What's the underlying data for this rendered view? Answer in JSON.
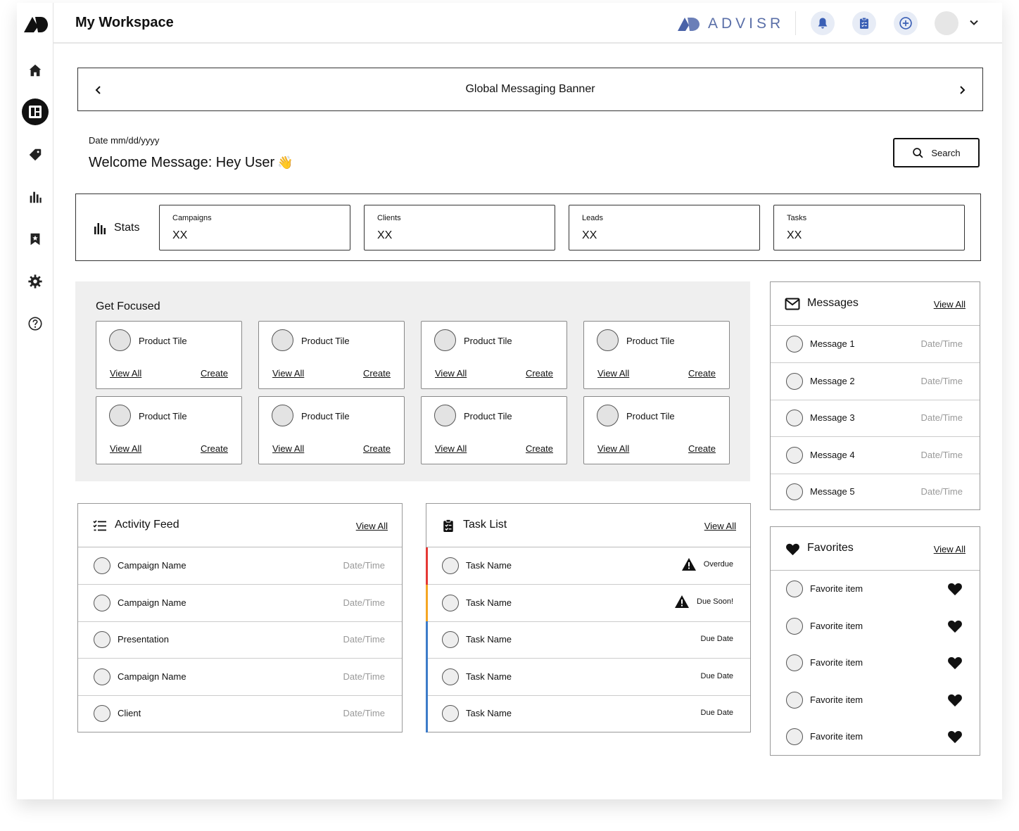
{
  "header": {
    "title": "My Workspace",
    "brand": "ADVISR"
  },
  "banner": {
    "text": "Global Messaging Banner"
  },
  "date_line": "Date mm/dd/yyyy",
  "welcome": "Welcome Message: Hey User",
  "search_label": "Search",
  "stats": {
    "label": "Stats",
    "cards": [
      {
        "label": "Campaigns",
        "value": "XX"
      },
      {
        "label": "Clients",
        "value": "XX"
      },
      {
        "label": "Leads",
        "value": "XX"
      },
      {
        "label": "Tasks",
        "value": "XX"
      }
    ]
  },
  "focused": {
    "title": "Get Focused",
    "tiles": [
      {
        "name": "Product Tile",
        "view": "View All",
        "create": "Create"
      },
      {
        "name": "Product Tile",
        "view": "View All",
        "create": "Create"
      },
      {
        "name": "Product Tile",
        "view": "View All",
        "create": "Create"
      },
      {
        "name": "Product Tile",
        "view": "View All",
        "create": "Create"
      },
      {
        "name": "Product Tile",
        "view": "View All",
        "create": "Create"
      },
      {
        "name": "Product Tile",
        "view": "View All",
        "create": "Create"
      },
      {
        "name": "Product Tile",
        "view": "View All",
        "create": "Create"
      },
      {
        "name": "Product Tile",
        "view": "View All",
        "create": "Create"
      }
    ]
  },
  "messages": {
    "title": "Messages",
    "view_all": "View All",
    "items": [
      {
        "name": "Message 1",
        "date": "Date/Time"
      },
      {
        "name": "Message 2",
        "date": "Date/Time"
      },
      {
        "name": "Message 3",
        "date": "Date/Time"
      },
      {
        "name": "Message 4",
        "date": "Date/Time"
      },
      {
        "name": "Message 5",
        "date": "Date/Time"
      }
    ]
  },
  "activity": {
    "title": "Activity Feed",
    "view_all": "View All",
    "items": [
      {
        "name": "Campaign Name",
        "date": "Date/Time"
      },
      {
        "name": "Campaign Name",
        "date": "Date/Time"
      },
      {
        "name": "Presentation",
        "date": "Date/Time"
      },
      {
        "name": "Campaign Name",
        "date": "Date/Time"
      },
      {
        "name": "Client",
        "date": "Date/Time"
      }
    ]
  },
  "tasks": {
    "title": "Task List",
    "view_all": "View All",
    "items": [
      {
        "name": "Task Name",
        "status": "Overdue",
        "color": "#e53935"
      },
      {
        "name": "Task Name",
        "status": "Due Soon!",
        "color": "#f5a623"
      },
      {
        "name": "Task Name",
        "status": "Due Date",
        "color": "#3d7cc9"
      },
      {
        "name": "Task Name",
        "status": "Due Date",
        "color": "#3d7cc9"
      },
      {
        "name": "Task Name",
        "status": "Due Date",
        "color": "#3d7cc9"
      }
    ]
  },
  "favorites": {
    "title": "Favorites",
    "view_all": "View All",
    "items": [
      {
        "name": "Favorite item"
      },
      {
        "name": "Favorite item"
      },
      {
        "name": "Favorite item"
      },
      {
        "name": "Favorite item"
      },
      {
        "name": "Favorite item"
      }
    ]
  },
  "colors": {
    "brand": "#5a6fa8",
    "header_button_bg": "#e7ecf6",
    "accent_icon": "#3a5fb5"
  },
  "icons": [
    "home-icon",
    "dashboard-icon",
    "tag-icon",
    "bar-chart-icon",
    "bookmark-icon",
    "gear-icon",
    "help-icon",
    "bell-icon",
    "clipboard-icon",
    "plus-circle-icon",
    "chevron-down-icon",
    "search-icon",
    "mail-icon",
    "list-icon",
    "heart-icon",
    "warning-icon"
  ]
}
